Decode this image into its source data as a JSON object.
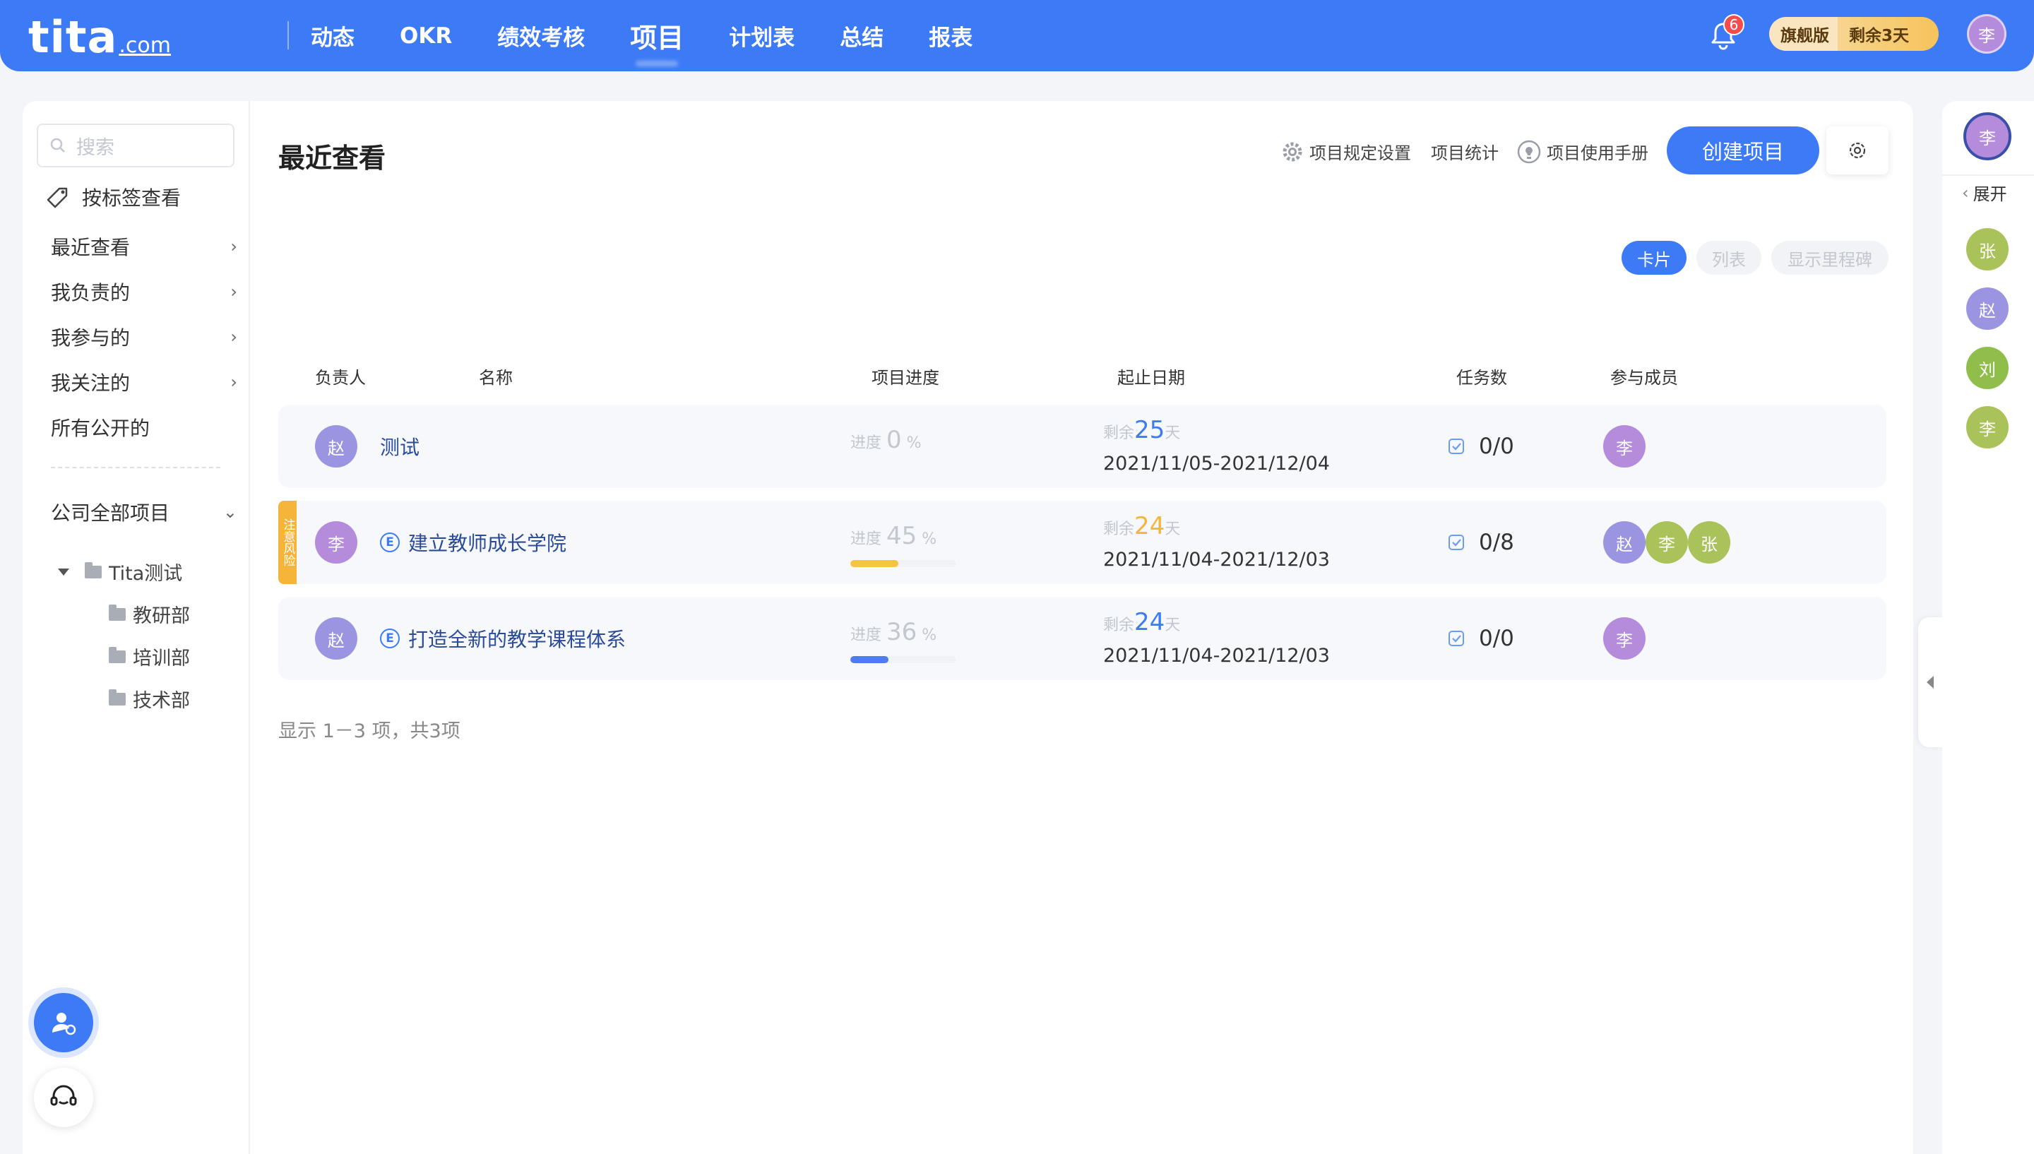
{
  "header": {
    "logo_main": "tita",
    "logo_suffix": ".com",
    "nav": [
      "动态",
      "OKR",
      "绩效考核",
      "项目",
      "计划表",
      "总结",
      "报表"
    ],
    "active_nav": "项目",
    "notification_count": "6",
    "plan_label": "旗舰版",
    "trial_label": "剩余3天",
    "user_avatar": "李"
  },
  "sidebar": {
    "search_placeholder": "搜索",
    "tag_view": "按标签查看",
    "items": [
      "最近查看",
      "我负责的",
      "我参与的",
      "我关注的",
      "所有公开的"
    ],
    "company_projects": "公司全部项目",
    "tree_root": "Tita测试",
    "tree_children": [
      "教研部",
      "培训部",
      "技术部"
    ]
  },
  "main": {
    "title": "最近查看",
    "toolbar": {
      "rules": "项目规定设置",
      "stats": "项目统计",
      "manual": "项目使用手册",
      "create": "创建项目"
    },
    "view_tabs": [
      "卡片",
      "列表",
      "显示里程碑"
    ],
    "columns": [
      "负责人",
      "名称",
      "项目进度",
      "起止日期",
      "任务数",
      "参与成员"
    ],
    "progress_label": "进度",
    "percent_sign": "%",
    "remaining_prefix": "剩余",
    "remaining_suffix": "天",
    "rows": [
      {
        "owner": "赵",
        "name": "测试",
        "has_e_icon": false,
        "progress": "0",
        "remaining": "25",
        "dates": "2021/11/05-2021/12/04",
        "tasks": "0/0",
        "members": [
          "李"
        ],
        "risk": ""
      },
      {
        "owner": "李",
        "name": "建立教师成长学院",
        "has_e_icon": true,
        "progress": "45",
        "remaining": "24",
        "dates": "2021/11/04-2021/12/03",
        "tasks": "0/8",
        "members": [
          "赵",
          "李",
          "张"
        ],
        "risk": "注意风险"
      },
      {
        "owner": "赵",
        "name": "打造全新的教学课程体系",
        "has_e_icon": true,
        "progress": "36",
        "remaining": "24",
        "dates": "2021/11/04-2021/12/03",
        "tasks": "0/0",
        "members": [
          "李"
        ],
        "risk": ""
      }
    ],
    "footer": "显示 1－3 项，共3项"
  },
  "right_panel": {
    "top_avatar": "李",
    "expand": "展开",
    "avatars": [
      "张",
      "赵",
      "刘",
      "李"
    ]
  },
  "colors": {
    "primary": "#3d7af5",
    "avatar_purple": "#b58bdc",
    "avatar_violet": "#9b94e0",
    "avatar_green": "#a9c25a",
    "progress_yellow": "#f5c542",
    "progress_blue": "#4e7cf0",
    "remaining_blue": "#3d7af5",
    "remaining_orange": "#f5b53a",
    "risk": "#f5b53a"
  }
}
